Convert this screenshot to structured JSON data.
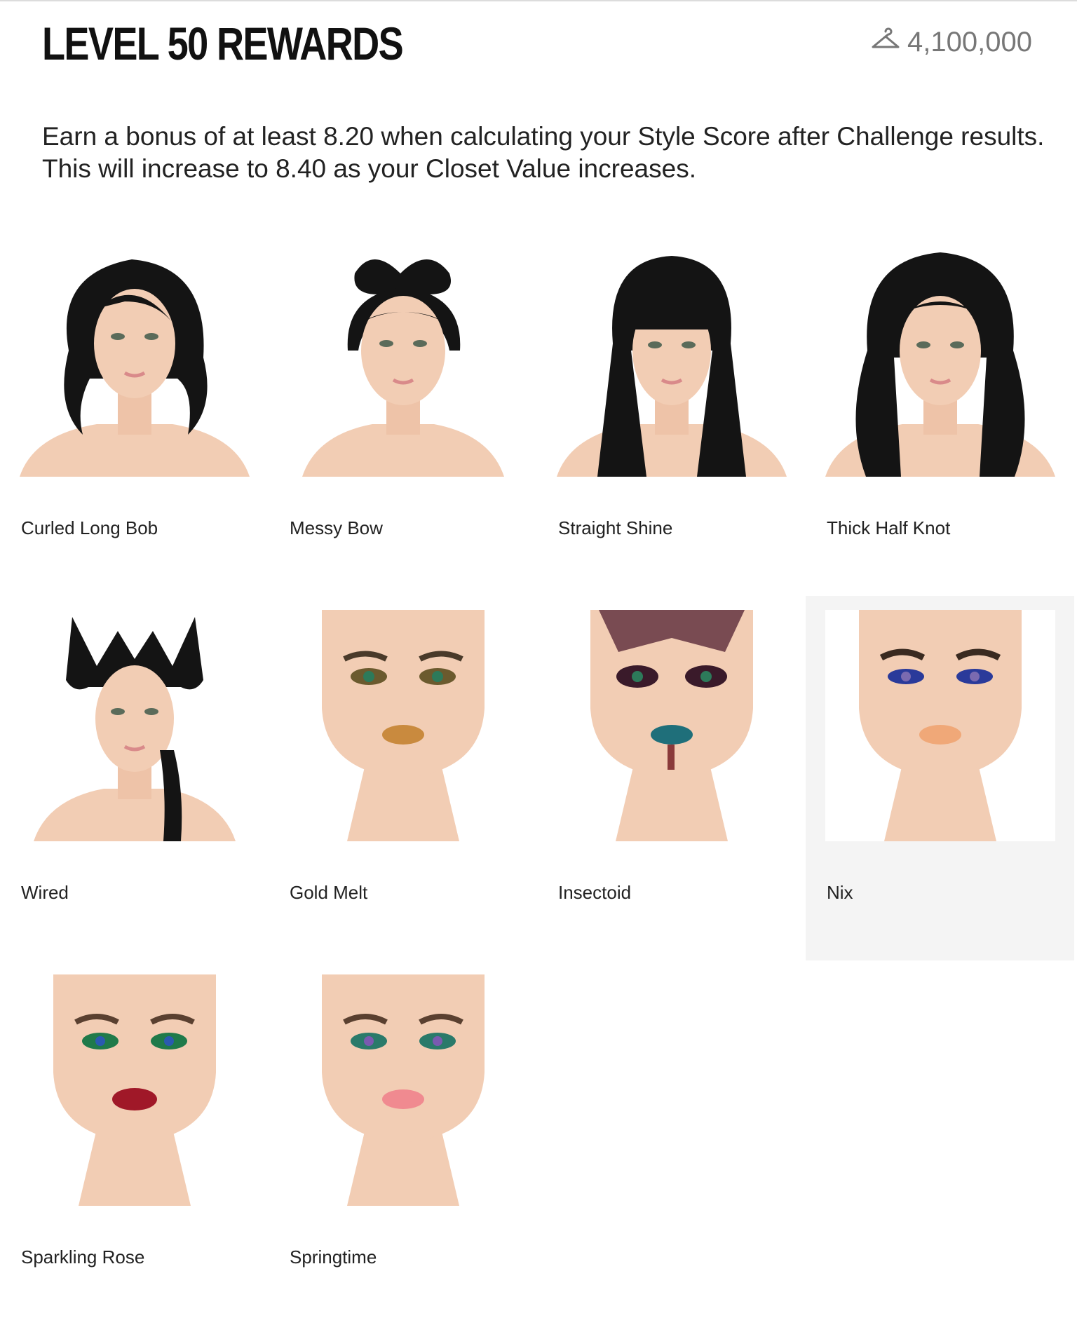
{
  "header": {
    "title": "LEVEL 50 REWARDS",
    "closet_value": "4,100,000",
    "closet_icon": "hanger-icon"
  },
  "description": {
    "line1": "Earn a bonus of at least 8.20 when calculating your Style Score after Challenge results.",
    "line2": "This will increase to 8.40 as your Closet Value increases."
  },
  "rewards": [
    {
      "name": "Curled Long Bob"
    },
    {
      "name": "Messy Bow"
    },
    {
      "name": "Straight Shine"
    },
    {
      "name": "Thick Half Knot"
    },
    {
      "name": "Wired"
    },
    {
      "name": "Gold Melt"
    },
    {
      "name": "Insectoid"
    },
    {
      "name": "Nix"
    },
    {
      "name": "Sparkling Rose"
    },
    {
      "name": "Springtime"
    }
  ],
  "colors": {
    "skin": "#f2cdb4",
    "hair": "#141414",
    "selected_bg": "#f4f4f4"
  }
}
